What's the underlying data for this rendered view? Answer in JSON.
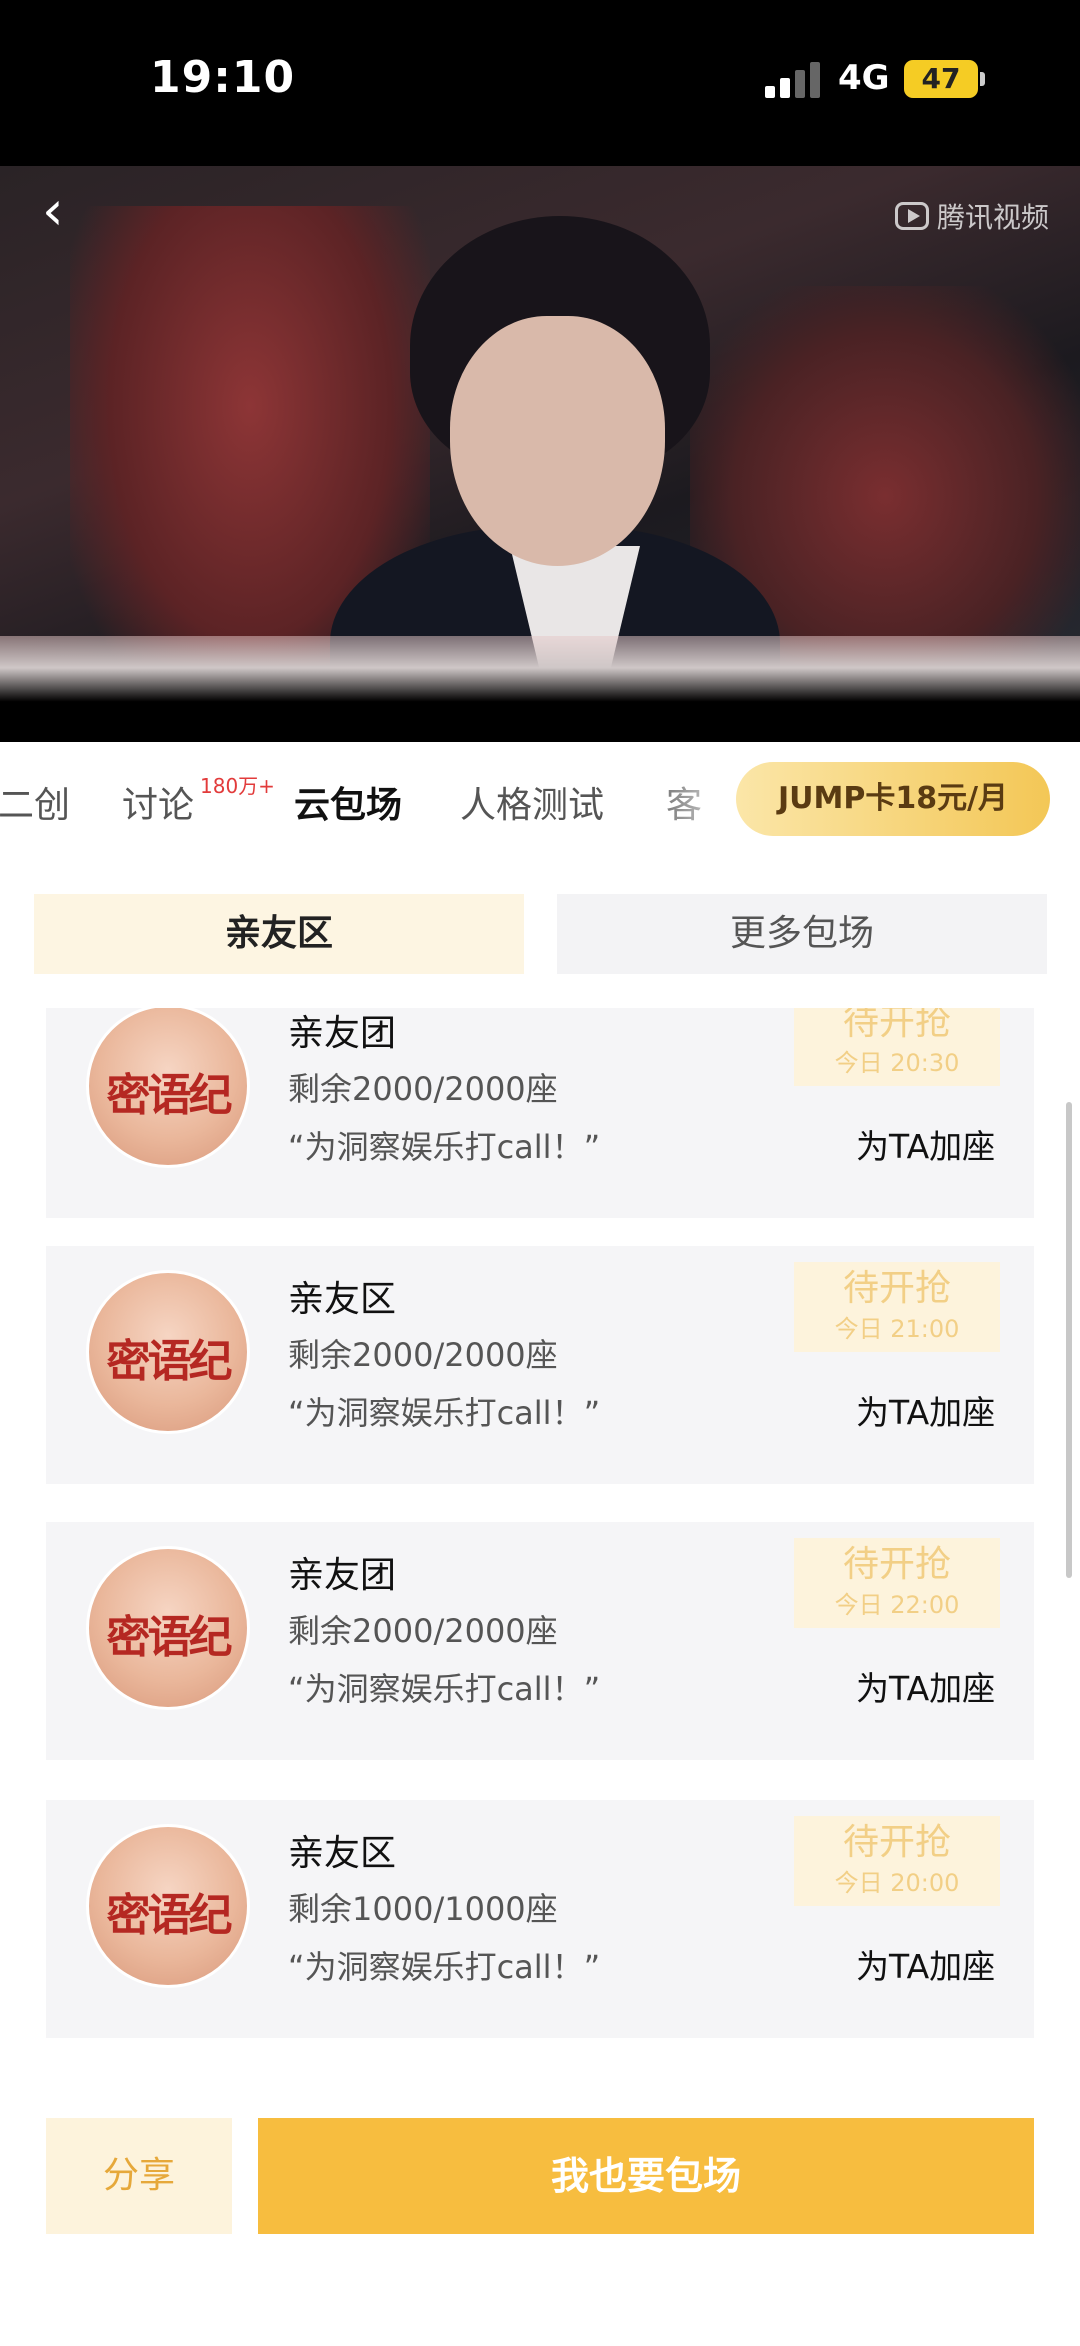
{
  "status_bar": {
    "time": "19:10",
    "network": "4G",
    "battery": "47"
  },
  "video": {
    "watermark": "腾讯视频"
  },
  "tabs": {
    "items": [
      {
        "label": "二创"
      },
      {
        "label": "讨论",
        "badge": "180万+"
      },
      {
        "label": "云包场"
      },
      {
        "label": "人格测试"
      },
      {
        "label": "客"
      }
    ],
    "jump_button": "JUMP卡18元/月"
  },
  "segment": {
    "left": "亲友区",
    "right": "更多包场"
  },
  "avatar_text": "密语纪",
  "sessions": [
    {
      "title": "亲友团",
      "seats": "剩余2000/2000座",
      "quote": "“为洞察娱乐打call！”",
      "status": "待开抢",
      "time": "今日 20:30",
      "action": "为TA加座"
    },
    {
      "title": "亲友区",
      "seats": "剩余2000/2000座",
      "quote": "“为洞察娱乐打call！”",
      "status": "待开抢",
      "time": "今日 21:00",
      "action": "为TA加座"
    },
    {
      "title": "亲友团",
      "seats": "剩余2000/2000座",
      "quote": "“为洞察娱乐打call！”",
      "status": "待开抢",
      "time": "今日 22:00",
      "action": "为TA加座"
    },
    {
      "title": "亲友区",
      "seats": "剩余1000/1000座",
      "quote": "“为洞察娱乐打call！”",
      "status": "待开抢",
      "time": "今日 20:00",
      "action": "为TA加座"
    }
  ],
  "bottom": {
    "share": "分享",
    "book": "我也要包场"
  }
}
